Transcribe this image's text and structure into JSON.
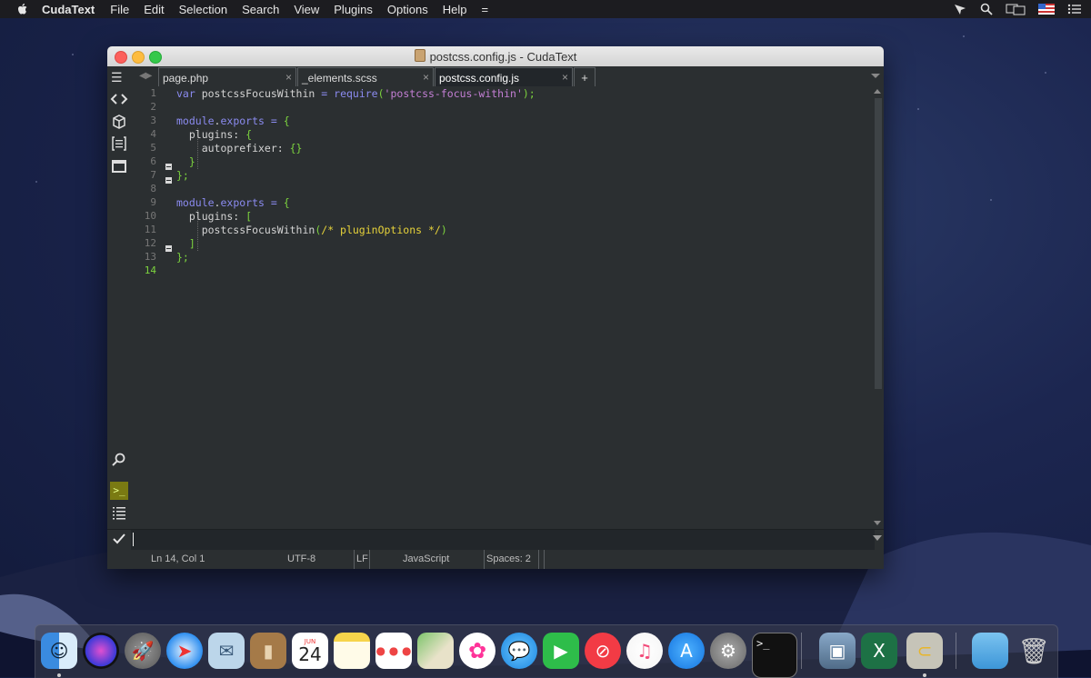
{
  "menubar": {
    "app_name": "CudaText",
    "items": [
      "File",
      "Edit",
      "Selection",
      "Search",
      "View",
      "Plugins",
      "Options",
      "Help",
      "="
    ]
  },
  "window": {
    "title": "postcss.config.js - CudaText"
  },
  "tabs": [
    {
      "label": "page.php",
      "close": "×"
    },
    {
      "label": "_elements.scss",
      "close": "×"
    },
    {
      "label": "postcss.config.js",
      "close": "×",
      "active": true
    },
    {
      "label": "+"
    }
  ],
  "editor": {
    "line_numbers": [
      "1",
      "2",
      "3",
      "4",
      "5",
      "6",
      "7",
      "8",
      "9",
      "10",
      "11",
      "12",
      "13",
      "14"
    ],
    "current_line": "14",
    "lines": [
      "var postcssFocusWithin = require('postcss-focus-within');",
      "",
      "module.exports = {",
      "  plugins: {",
      "    autoprefixer: {}",
      "  }",
      "};",
      "",
      "module.exports = {",
      "  plugins: [",
      "    postcssFocusWithin(/* pluginOptions */)",
      "  ]",
      "};",
      ""
    ]
  },
  "command_bar": {
    "value": ""
  },
  "statusbar": {
    "position": "Ln 14, Col 1",
    "encoding": "UTF-8",
    "line_ending": "LF",
    "lexer": "JavaScript",
    "indent": "Spaces: 2"
  },
  "colors": {
    "keyword": "#8b8bf0",
    "string": "#c47fd5",
    "punctuation": "#7cd33e",
    "comment": "#e6d23a",
    "editor_bg": "#2b2f31"
  },
  "dock": {
    "calendar_month": "JUN",
    "calendar_day": "24",
    "icons": [
      "finder-icon",
      "siri-icon",
      "launchpad-icon",
      "safari-icon",
      "mail-icon",
      "contacts-icon",
      "calendar-icon",
      "notes-icon",
      "reminders-icon",
      "maps-icon",
      "photos-icon",
      "messages-icon",
      "facetime-icon",
      "news-icon",
      "music-icon",
      "app-store-icon",
      "system-preferences-icon",
      "terminal-icon",
      "preview-icon",
      "excel-icon",
      "cudatext-icon",
      "downloads-folder-icon",
      "trash-icon"
    ]
  }
}
